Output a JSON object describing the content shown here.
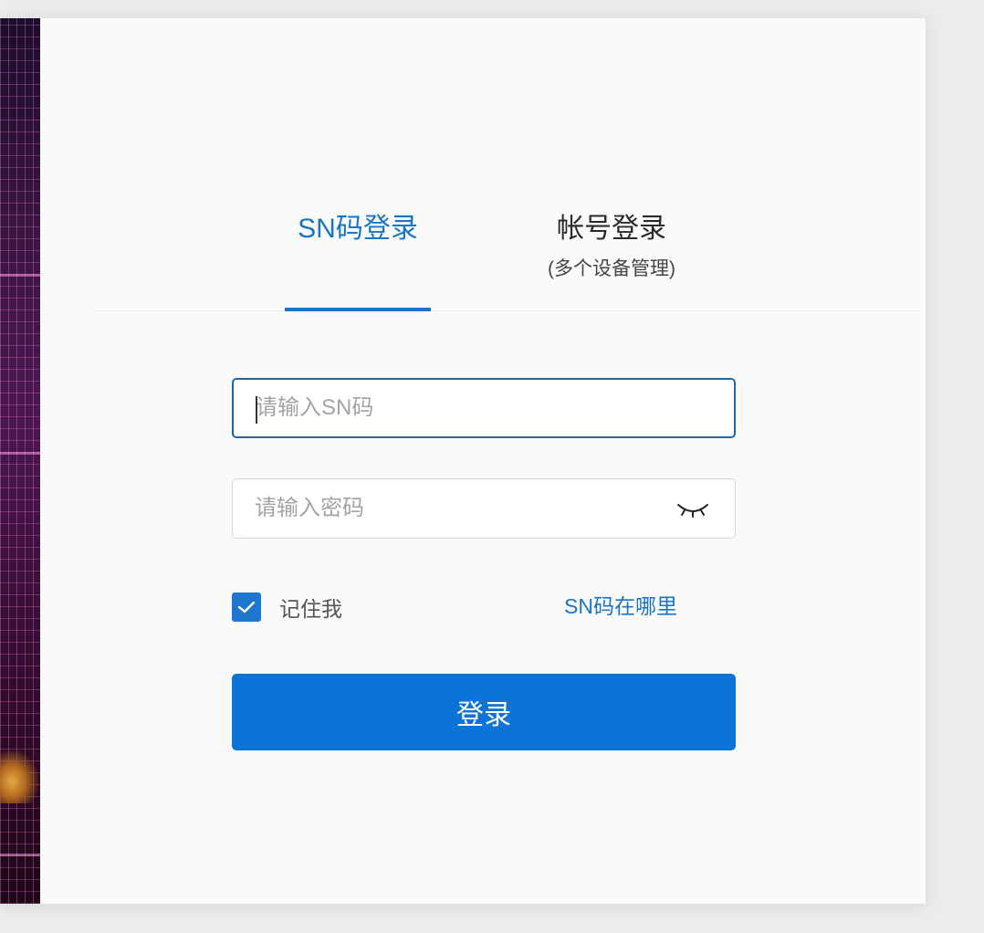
{
  "tabs": {
    "sn_login": {
      "label": "SN码登录"
    },
    "account_login": {
      "label": "帐号登录",
      "sublabel": "(多个设备管理)"
    }
  },
  "fields": {
    "sn": {
      "placeholder": "请输入SN码",
      "value": ""
    },
    "password": {
      "placeholder": "请输入密码",
      "value": "",
      "toggle_icon": "eye-closed-icon"
    }
  },
  "remember": {
    "label": "记住我",
    "checked": true,
    "icon": "checkmark-icon"
  },
  "help_link": {
    "label": "SN码在哪里"
  },
  "login_button": {
    "label": "登录"
  },
  "colors": {
    "accent": "#1b74c4",
    "button": "#0b74d6",
    "checkbox": "#1e77cf",
    "active_border": "#1a6aa8",
    "background": "#fafafa"
  }
}
